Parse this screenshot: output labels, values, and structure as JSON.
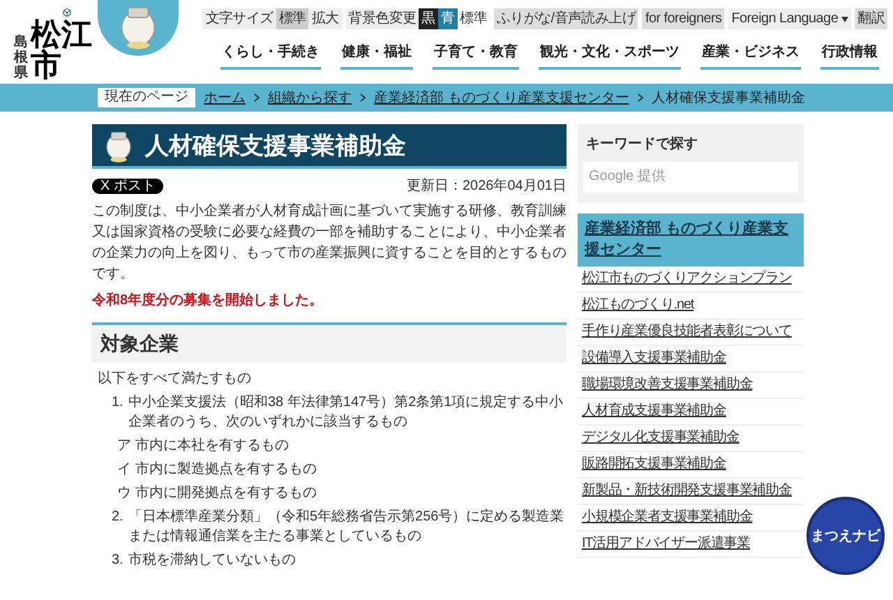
{
  "header": {
    "logo": {
      "prefecture": "島根県",
      "city": "松江市"
    },
    "text_size": {
      "label": "文字サイズ",
      "options": [
        {
          "label": "標準",
          "selected": true
        },
        {
          "label": "拡大",
          "selected": false
        }
      ]
    },
    "bg_color": {
      "label": "背景色変更",
      "options": [
        {
          "label": "黒",
          "color": "#222222"
        },
        {
          "label": "青",
          "color": "#1f7fa6"
        },
        {
          "label": "標準",
          "color": "#ffffff"
        }
      ]
    },
    "buttons": [
      "ふりがな/音声読み上げ",
      "for foreigners"
    ],
    "language": {
      "value": "Foreign Language"
    },
    "translate": "翻訳",
    "nav": [
      "くらし・手続き",
      "健康・福祉",
      "子育て・教育",
      "観光・文化・スポーツ",
      "産業・ビジネス",
      "行政情報"
    ]
  },
  "breadcrumb": {
    "label": "現在のページ",
    "items": [
      {
        "text": "ホーム",
        "link": true
      },
      {
        "text": "組織から探す",
        "link": true
      },
      {
        "text": "産業経済部 ものづくり産業支援センター",
        "link": true
      },
      {
        "text": "人材確保支援事業補助金",
        "link": false
      }
    ]
  },
  "page": {
    "title": "人材確保支援事業補助金",
    "share": "X ポスト",
    "updated": "更新日：2026年04月01日",
    "intro": "この制度は、中小企業者が人材育成計画に基づいて実施する研修、教育訓練又は国家資格の受験に必要な経費の一部を補助することにより、中小企業者の企業力の向上を図り、もって市の産業振興に資することを目的とするものです。",
    "notice": "令和8年度分の募集を開始しました。",
    "section": {
      "heading": "対象企業",
      "lead": "以下をすべて満たすもの",
      "items": [
        {
          "kind": "numbered",
          "marker": "1.",
          "text": "中小企業支援法（昭和38 年法律第147号）第2条第1項に規定する中小企業者のうち、次のいずれかに該当するもの"
        },
        {
          "kind": "sub",
          "text": "ア 市内に本社を有するもの"
        },
        {
          "kind": "sub",
          "text": "イ 市内に製造拠点を有するもの"
        },
        {
          "kind": "sub",
          "text": "ウ 市内に開発拠点を有するもの"
        },
        {
          "kind": "numbered",
          "marker": "2.",
          "text": "「日本標準産業分類」（令和5年総務省告示第256号）に定める製造業または情報通信業を主たる事業としているもの"
        },
        {
          "kind": "numbered",
          "marker": "3.",
          "text": "市税を滞納していないもの"
        }
      ]
    }
  },
  "sidebar": {
    "search": {
      "title": "キーワードで探す",
      "placeholder": "Google 提供"
    },
    "department": {
      "title": "産業経済部 ものづくり産業支援センター",
      "links": [
        "松江市ものづくりアクションプラン",
        "松江ものづくり.net",
        "手作り産業優良技能者表彰について",
        "設備導入支援事業補助金",
        "職場環境改善支援事業補助金",
        "人材育成支援事業補助金",
        "デジタル化支援事業補助金",
        "販路開拓支援事業補助金",
        "新製品・新技術開発支援事業補助金",
        "小規模企業者支援事業補助金",
        "IT活用アドバイザー派遣事業"
      ]
    }
  },
  "navi_badge": {
    "text": "まつえナビ"
  }
}
